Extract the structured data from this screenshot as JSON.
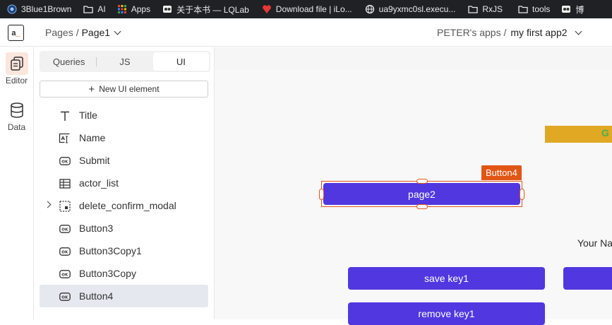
{
  "bookmarks": [
    {
      "label": "3Blue1Brown",
      "icon": "blue-circle-icon"
    },
    {
      "label": "AI",
      "icon": "folder-icon"
    },
    {
      "label": "Apps",
      "icon": "apps-grid-icon"
    },
    {
      "label": "关于本书 — LQLab",
      "icon": "site-favicon-icon"
    },
    {
      "label": "Download file | iLo...",
      "icon": "red-favicon-icon"
    },
    {
      "label": "ua9yxmc0sl.execu...",
      "icon": "globe-icon"
    },
    {
      "label": "RxJS",
      "icon": "folder-icon"
    },
    {
      "label": "tools",
      "icon": "folder-icon"
    },
    {
      "label": "博",
      "icon": "site-favicon-icon"
    }
  ],
  "header": {
    "pages_label": "Pages",
    "separator": "/",
    "page_name": "Page1",
    "workspace": "PETER's apps /",
    "app_name": "my first app2"
  },
  "rail": {
    "editor_label": "Editor",
    "data_label": "Data"
  },
  "sidebar": {
    "tabs": [
      "Queries",
      "JS",
      "UI"
    ],
    "active_tab": "UI",
    "new_button": "New UI element",
    "items": [
      {
        "name": "Title",
        "icon": "text-icon"
      },
      {
        "name": "Name",
        "icon": "input-icon"
      },
      {
        "name": "Submit",
        "icon": "button-icon"
      },
      {
        "name": "actor_list",
        "icon": "table-icon"
      },
      {
        "name": "delete_confirm_modal",
        "icon": "modal-icon",
        "expandable": true
      },
      {
        "name": "Button3",
        "icon": "button-icon"
      },
      {
        "name": "Button3Copy1",
        "icon": "button-icon"
      },
      {
        "name": "Button3Copy",
        "icon": "button-icon"
      },
      {
        "name": "Button4",
        "icon": "button-icon",
        "selected": true
      }
    ]
  },
  "canvas": {
    "yellow_bar_text": "G",
    "selected_widget_label": "Button4",
    "page2_button": "page2",
    "your_name_text": "Your Na",
    "save_key_button": "save key1",
    "remove_key_button": "remove key1"
  },
  "colors": {
    "accent": "#e15615",
    "button": "#5137e0",
    "yellow": "#e0a823",
    "selected_row": "#e5e8ef"
  }
}
